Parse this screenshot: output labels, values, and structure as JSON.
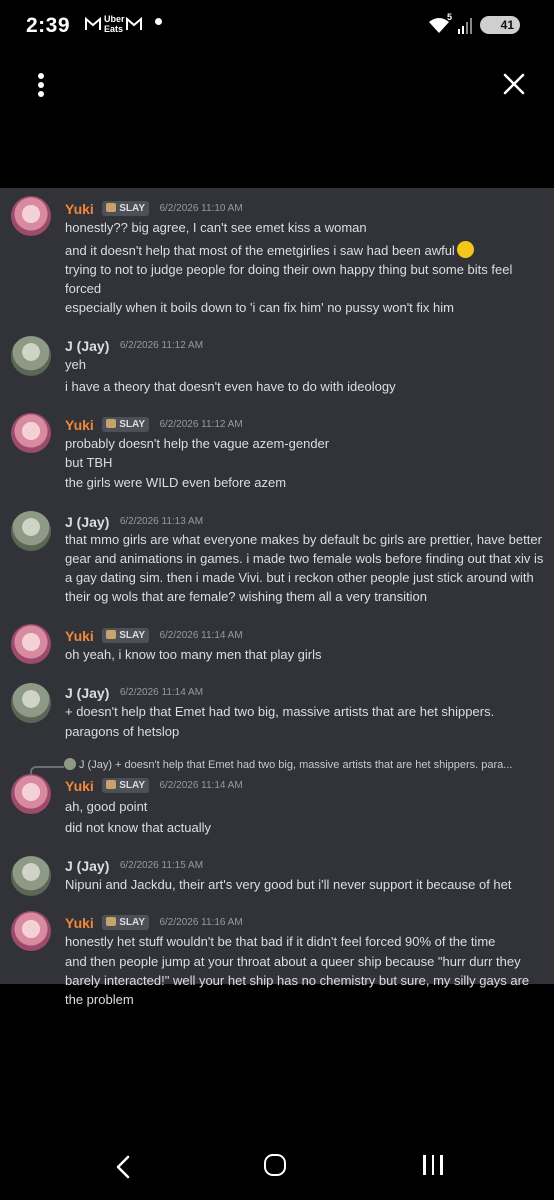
{
  "status_bar": {
    "time": "2:39",
    "uber_line1": "Uber",
    "uber_line2": "Eats",
    "wifi_badge": "5",
    "battery": "41"
  },
  "colors": {
    "chat_bg": "#313338",
    "yuki_name": "#f0873b",
    "text": "#dbdee1",
    "timestamp": "#949ba4"
  },
  "messages": [
    {
      "author": "Yuki",
      "tag": "SLAY",
      "timestamp": "6/2/2026 11:10 AM",
      "lines": [
        "honestly?? big agree, I can't see emet kiss a woman",
        "and it doesn't help that most of the emetgirlies i saw had been awful",
        "trying to not to judge people for doing their own happy thing but some bits feel forced",
        "especially when it boils down to 'i can fix him' no pussy won't fix him"
      ]
    },
    {
      "author": "J (Jay)",
      "timestamp": "6/2/2026 11:12 AM",
      "lines": [
        "yeh",
        "i have a theory that doesn't even have to do with ideology"
      ]
    },
    {
      "author": "Yuki",
      "tag": "SLAY",
      "timestamp": "6/2/2026 11:12 AM",
      "lines": [
        "probably doesn't help the vague azem-gender",
        "but TBH",
        "the girls were WILD even before azem"
      ]
    },
    {
      "author": "J (Jay)",
      "timestamp": "6/2/2026 11:13 AM",
      "lines": [
        "that mmo girls are what everyone makes by default bc girls are prettier, have better gear and animations in games. i made two female wols before finding out that xiv is a gay dating sim. then i made Vivi. but i reckon other people just stick around with their og wols that are female? wishing them all a very transition"
      ]
    },
    {
      "author": "Yuki",
      "tag": "SLAY",
      "timestamp": "6/2/2026 11:14 AM",
      "lines": [
        "oh yeah, i know too many men that play girls"
      ]
    },
    {
      "author": "J (Jay)",
      "timestamp": "6/2/2026 11:14 AM",
      "lines": [
        "+ doesn't help that Emet had two big, massive artists that are het shippers.",
        "paragons of hetslop"
      ]
    },
    {
      "reply_preview": "J (Jay) + doesn't help that Emet had two big, massive artists that are het shippers. para...",
      "author": "Yuki",
      "tag": "SLAY",
      "timestamp": "6/2/2026 11:14 AM",
      "lines": [
        "ah, good point",
        "did not know that actually"
      ]
    },
    {
      "author": "J (Jay)",
      "timestamp": "6/2/2026 11:15 AM",
      "lines": [
        "Nipuni and Jackdu, their art's very good but i'll never support it because of het"
      ]
    },
    {
      "author": "Yuki",
      "tag": "SLAY",
      "timestamp": "6/2/2026 11:16 AM",
      "lines": [
        "honestly het stuff wouldn't be that bad if it didn't feel forced 90% of the time",
        "and then people jump at your throat about a queer ship because \"hurr durr they barely interacted!\" well your het ship has no chemistry but sure, my silly gays are the problem"
      ]
    }
  ]
}
